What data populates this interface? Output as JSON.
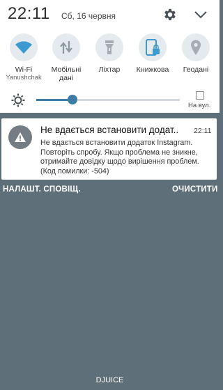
{
  "status": {
    "time": "22:11",
    "date": "Сб, 16 червня"
  },
  "toggles": [
    {
      "label": "Wi-Fi",
      "sublabel": "Yanushchak",
      "icon": "wifi-icon",
      "active": true
    },
    {
      "label": "Мобільні дані",
      "sublabel": "",
      "icon": "mobile-data-icon",
      "active": false
    },
    {
      "label": "Ліхтар",
      "sublabel": "",
      "icon": "flashlight-icon",
      "active": false
    },
    {
      "label": "Книжкова",
      "sublabel": "",
      "icon": "rotation-lock-icon",
      "active": true
    },
    {
      "label": "Геодані",
      "sublabel": "",
      "icon": "location-icon",
      "active": false
    }
  ],
  "brightness": {
    "level": 0.25,
    "auto_label": "На вул.",
    "auto_checked": false
  },
  "notification": {
    "title": "Не вдається встановити додат..",
    "time": "22:11",
    "body": "Не вдається встановити додаток Instagram. Повторіть спробу. Якщо проблема не зникне, отримайте довідку щодо вирішення проблем. (Код помилки: -504)",
    "icon": "warning-icon"
  },
  "actions": {
    "settings_label": "НАЛАШТ. СПОВІЩ.",
    "clear_label": "ОЧИСТИТИ"
  },
  "carrier": "DJUICE",
  "colors": {
    "accent": "#3d7da5",
    "background": "#5f6f79",
    "toggle_bg": "#e4eaee"
  }
}
